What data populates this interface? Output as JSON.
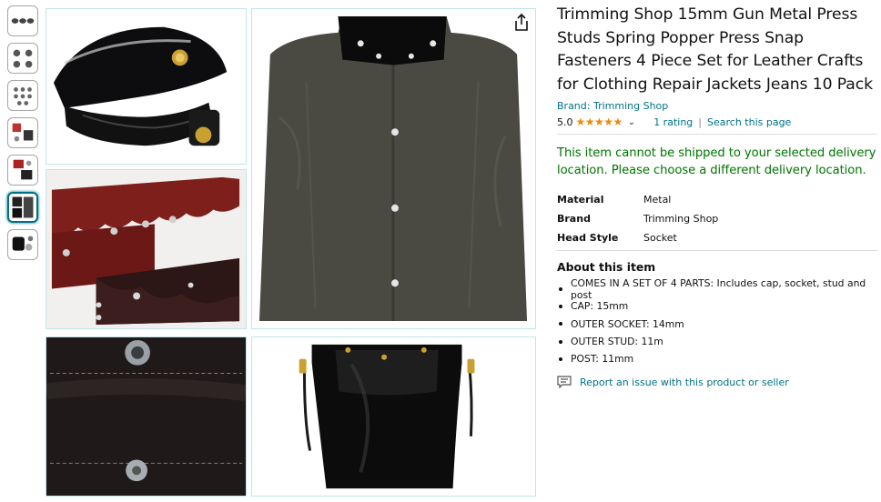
{
  "product": {
    "title": "Trimming Shop 15mm Gun Metal Press Studs Spring Popper Press Snap Fasteners 4 Piece Set for Leather Crafts for Clothing Repair Jackets Jeans 10 Pack",
    "brand_link": "Brand: Trimming Shop",
    "rating_value": "5.0",
    "stars": "★★★★★",
    "rating_fraction": 1.0,
    "rating_count": "1 rating",
    "search_link": "Search this page",
    "shipping_notice": "This item cannot be shipped to your selected delivery location. Please choose a different delivery location."
  },
  "specs": [
    {
      "key": "Material",
      "value": "Metal"
    },
    {
      "key": "Brand",
      "value": "Trimming Shop"
    },
    {
      "key": "Head Style",
      "value": "Socket"
    }
  ],
  "about": {
    "heading": "About this item",
    "bullets": [
      "COMES IN A SET OF 4 PARTS: Includes cap, socket, stud and post",
      "CAP: 15mm",
      "OUTER SOCKET: 14mm",
      "OUTER STUD: 11m",
      "POST: 11mm"
    ]
  },
  "report_link": "Report an issue with this product or seller",
  "gallery": {
    "thumbnail_count": 7,
    "active_thumbnail": 6,
    "icons": [
      "share-icon",
      "report-icon",
      "chevron-down-icon"
    ],
    "colors": {
      "link": "#007185",
      "ship_notice": "#007600",
      "star": "#f08804"
    }
  }
}
